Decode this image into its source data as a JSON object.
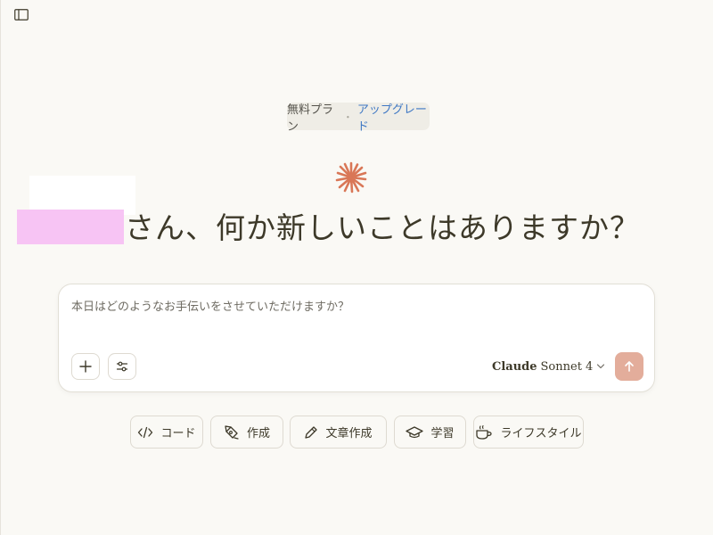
{
  "icons": {
    "sidebar_toggle": "sidebar-panel-icon",
    "add": "plus-icon",
    "tools": "sliders-icon",
    "send": "arrow-up-icon",
    "model_dropdown": "chevron-down-icon"
  },
  "plan": {
    "label": "無料プラン",
    "separator": "・",
    "upgrade_link": "アップグレード"
  },
  "greeting": {
    "text": "さん、何か新しいことはありますか？"
  },
  "composer": {
    "placeholder": "本日はどのようなお手伝いをさせていただけますか？",
    "value": "",
    "model_family": "Claude",
    "model_name": "Sonnet 4"
  },
  "chips": [
    {
      "label": "コード",
      "icon": "code-icon"
    },
    {
      "label": "作成",
      "icon": "pen-tool-icon"
    },
    {
      "label": "文章作成",
      "icon": "pencil-icon"
    },
    {
      "label": "学習",
      "icon": "graduation-cap-icon"
    },
    {
      "label": "ライフスタイル",
      "icon": "coffee-cup-icon"
    }
  ],
  "colors": {
    "background": "#faf9f5",
    "accent": "#d97757",
    "link": "#3f78c4",
    "send_button": "#e3ad9b",
    "redaction": "#f7c4f4"
  }
}
